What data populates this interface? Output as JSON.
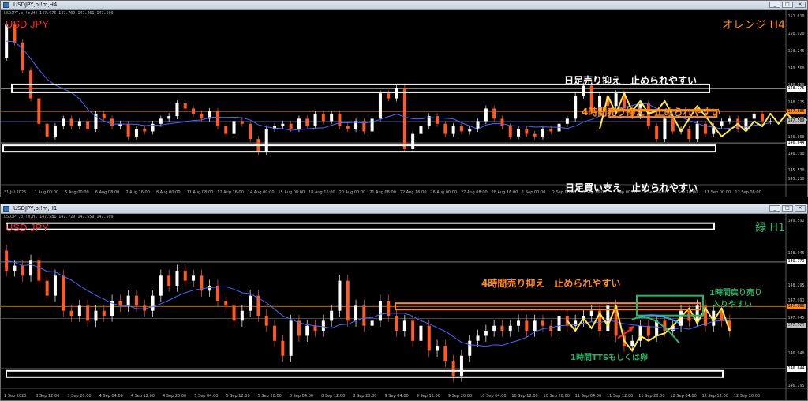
{
  "colors": {
    "bull": "#ffffff",
    "bear": "#ff5a1f",
    "ma": "#4a67ff",
    "orange": "#ff8c1a",
    "green": "#2fb36a",
    "yellow": "#ffe94a",
    "projection": "#3aa0e8",
    "symbol": "#ff2b2b",
    "grid": "#9a9a9a"
  },
  "h4": {
    "title": "USDJPY,oj!m,H4",
    "info": "USDJPY,oj!m,H4  147.676 147.709 147.461 147.509",
    "symbol": "USD JPY",
    "timeframe_label": "オレンジ H4",
    "annotations": {
      "resist_daily": "日足売り抑え　止められやすい",
      "resist_h4": "4時間売り抑え　止められやすい",
      "support_daily": "日足買い支え　止められやすい"
    },
    "price_labels": [
      "151.610",
      "150.920",
      "150.245",
      "149.560",
      "148.890",
      "148.775",
      "148.225",
      "147.886",
      "147.565",
      "147.509",
      "146.860",
      "146.644",
      "146.190",
      "145.530",
      "145.210"
    ],
    "price_label_values": [
      151.61,
      150.92,
      150.245,
      149.56,
      148.89,
      148.775,
      148.225,
      147.886,
      147.565,
      147.509,
      146.86,
      146.644,
      146.19,
      145.53,
      145.21
    ],
    "levels": {
      "resistance_white": 148.775,
      "h4_orange": 147.886,
      "blue": 147.51,
      "support_white": 146.644
    },
    "x_labels": [
      "31 Jul 2025",
      "1 Aug 00:00",
      "5 Aug 00:00",
      "6 Aug 08:00",
      "7 Aug 16:00",
      "8 Aug 00:00",
      "11 Aug 08:00",
      "12 Aug 16:00",
      "14 Aug 00:00",
      "15 Aug 08:00",
      "18 Aug 16:00",
      "20 Aug 00:00",
      "21 Aug 08:00",
      "22 Aug 16:00",
      "26 Aug 00:00",
      "27 Aug 08:00",
      "28 Aug 16:00",
      "1 Sep 00:00",
      "2 Sep 08:00",
      "3 Sep 16:00",
      "5 Sep 00:00",
      "8 Sep 08:00",
      "9 Sep 16:00",
      "11 Sep 00:00",
      "12 Sep 08:00"
    ],
    "ymin": 145.0,
    "ymax": 151.9,
    "path": [
      150.0,
      151.3,
      150.6,
      149.5,
      148.4,
      147.4,
      146.9,
      147.3,
      147.6,
      147.3,
      147.5,
      147.2,
      147.8,
      147.6,
      147.3,
      147.4,
      146.9,
      147.2,
      147.1,
      147.4,
      147.6,
      147.7,
      148.2,
      148.0,
      147.8,
      147.6,
      147.9,
      147.3,
      147.0,
      147.5,
      147.4,
      146.8,
      146.3,
      147.2,
      147.3,
      147.4,
      147.2,
      147.6,
      147.3,
      147.8,
      147.5,
      147.8,
      147.3,
      147.2,
      147.5,
      147.1,
      147.6,
      148.6,
      148.4,
      148.8,
      146.4,
      147.0,
      147.3,
      147.7,
      147.4,
      147.0,
      147.3,
      147.1,
      147.2,
      147.5,
      148.0,
      147.6,
      147.3,
      146.9,
      147.2,
      147.0,
      146.9,
      147.2,
      147.1,
      147.4,
      147.6,
      148.5,
      148.9,
      147.9,
      148.5,
      148.1,
      148.6,
      148.0,
      147.7,
      148.2,
      147.3,
      146.8,
      147.6,
      147.1,
      147.2,
      146.8,
      147.4,
      147.0,
      147.3,
      147.5,
      147.6,
      147.2,
      147.6,
      147.8,
      147.5,
      147.5
    ],
    "zigzag": [
      [
        73,
        147.2
      ],
      [
        74,
        148.5
      ],
      [
        75,
        147.8
      ],
      [
        76,
        148.6
      ],
      [
        77,
        147.9
      ],
      [
        78,
        148.3
      ],
      [
        79,
        147.8
      ],
      [
        80,
        147.9
      ],
      [
        81,
        148.3
      ],
      [
        83,
        147.1
      ],
      [
        85,
        148.1
      ],
      [
        88,
        146.9
      ],
      [
        90,
        147.4
      ],
      [
        91,
        147.1
      ],
      [
        92,
        147.5
      ],
      [
        93,
        147.3
      ],
      [
        94,
        147.8
      ],
      [
        95,
        147.4
      ],
      [
        96,
        147.8
      ],
      [
        97,
        147.5
      ]
    ],
    "projection": [
      [
        97.5,
        147.45
      ],
      [
        98.5,
        147.55
      ],
      [
        99.5,
        147.6
      ]
    ]
  },
  "h1": {
    "title": "USDJPY,oj!m,H1",
    "info": "USDJPY,oj!m,H1  147.581 147.729 147.559 147.509",
    "symbol": "USD JPY",
    "timeframe_label": "緑 H1",
    "annotations": {
      "resist_h4": "4時間売り抑え　止められやすい",
      "h1_pullback": "1時間戻り売り",
      "h1_entry": "入りやすい",
      "tts": "1時間TTSもしくは卵"
    },
    "price_labels": [
      "149.592",
      "148.945",
      "148.773",
      "148.295",
      "147.991",
      "147.886",
      "147.645",
      "147.509",
      "147.475",
      "146.940",
      "146.644",
      "146.295"
    ],
    "price_label_values": [
      149.592,
      148.945,
      148.773,
      148.295,
      147.991,
      147.886,
      147.645,
      147.509,
      147.475,
      146.94,
      146.644,
      146.295
    ],
    "levels": {
      "resistance_white": 148.773,
      "h4_orange": 147.886,
      "level2": 147.645,
      "support_white": 146.644
    },
    "x_labels": [
      "1 Sep 2025",
      "3 Sep 12:00",
      "3 Sep 20:00",
      "4 Sep 04:00",
      "4 Sep 12:00",
      "4 Sep 20:00",
      "5 Sep 04:00",
      "5 Sep 12:00",
      "5 Sep 20:00",
      "8 Sep 04:00",
      "8 Sep 12:00",
      "8 Sep 20:00",
      "9 Sep 04:00",
      "9 Sep 12:00",
      "9 Sep 20:00",
      "10 Sep 04:00",
      "10 Sep 12:00",
      "10 Sep 20:00",
      "11 Sep 04:00",
      "11 Sep 12:00",
      "11 Sep 20:00",
      "12 Sep 04:00",
      "12 Sep 12:00",
      "12 Sep 20:00"
    ],
    "ymin": 146.25,
    "ymax": 149.75,
    "path": [
      149.0,
      148.6,
      148.7,
      148.5,
      148.8,
      148.4,
      148.1,
      148.5,
      147.8,
      147.7,
      147.9,
      147.6,
      147.8,
      147.7,
      148.0,
      147.9,
      148.1,
      147.9,
      147.8,
      148.1,
      148.5,
      148.3,
      148.6,
      148.4,
      148.5,
      148.2,
      148.3,
      148.0,
      147.9,
      147.6,
      147.8,
      148.1,
      147.7,
      147.5,
      147.2,
      146.9,
      147.6,
      147.3,
      147.5,
      147.4,
      147.6,
      147.8,
      148.4,
      147.6,
      147.9,
      147.5,
      147.6,
      148.0,
      147.7,
      147.4,
      147.6,
      147.2,
      147.5,
      147.0,
      147.1,
      146.8,
      146.5,
      146.9,
      147.2,
      147.3,
      147.4,
      147.5,
      147.4,
      147.5,
      147.6,
      147.4,
      147.6,
      147.5,
      147.4,
      147.7,
      147.5,
      147.6,
      147.7,
      147.8,
      147.4,
      147.9,
      147.3,
      147.1,
      147.2,
      147.5,
      147.3,
      147.6,
      147.4,
      147.5,
      147.8,
      147.6,
      147.9,
      147.5,
      147.8,
      147.6,
      147.4
    ],
    "zigzag": [
      [
        69,
        147.6
      ],
      [
        70,
        147.4
      ],
      [
        71,
        147.65
      ],
      [
        72,
        147.45
      ],
      [
        73,
        147.75
      ],
      [
        74,
        147.5
      ],
      [
        75,
        147.9
      ],
      [
        76,
        147.2
      ],
      [
        77,
        147.0
      ],
      [
        78,
        147.3
      ],
      [
        79,
        147.2
      ],
      [
        80,
        147.3
      ],
      [
        81,
        147.35
      ],
      [
        82,
        147.5
      ],
      [
        84,
        147.85
      ],
      [
        85,
        147.55
      ],
      [
        86,
        147.85
      ],
      [
        87,
        147.6
      ],
      [
        88,
        147.85
      ],
      [
        89,
        147.4
      ]
    ],
    "proj_blue": [
      [
        89,
        147.62
      ],
      [
        90,
        147.78
      ],
      [
        91,
        147.72
      ],
      [
        92,
        147.55
      ]
    ],
    "proj_green": [
      [
        89,
        147.62
      ],
      [
        90,
        147.78
      ],
      [
        91,
        147.55
      ],
      [
        92,
        147.15
      ]
    ]
  }
}
